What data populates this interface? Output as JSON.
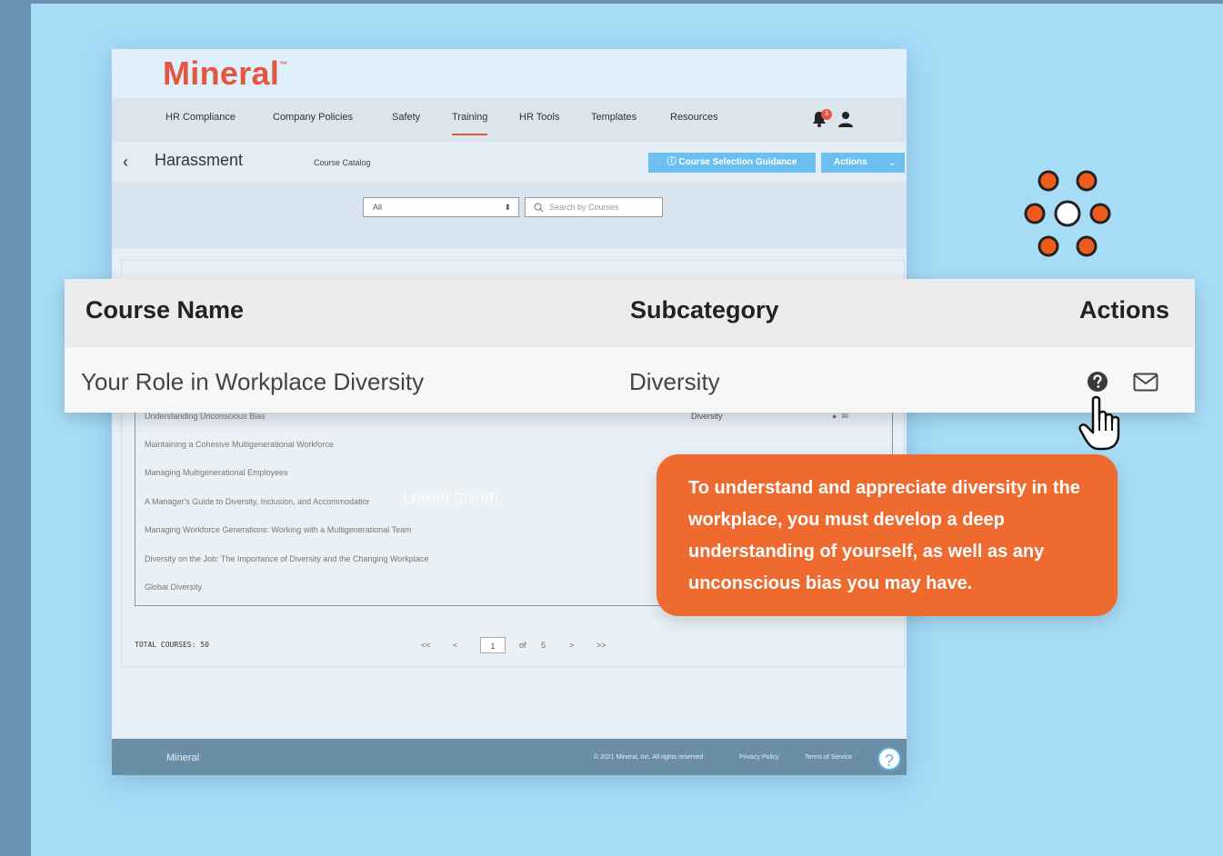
{
  "app": {
    "logo": "Mineral",
    "logo_tm": "™",
    "nav": [
      "HR Compliance",
      "Company Policies",
      "Safety",
      "Training",
      "HR Tools",
      "Templates",
      "Resources"
    ],
    "active_nav": "Training",
    "notification_count": "3",
    "page_title": "Harassment",
    "breadcrumb": "Course Catalog",
    "guidance_button": "Course Selection Guidance",
    "actions_button": "Actions",
    "filter_value": "All",
    "search_placeholder": "Search by Courses"
  },
  "course_list": {
    "rows": [
      {
        "name": "Understanding Unconscious Bias",
        "subcategory": "Diversity"
      },
      {
        "name": "Maintaining a Cohesive Multigenerational Workforce",
        "subcategory": ""
      },
      {
        "name": "Managing Multigenerational Employees",
        "subcategory": ""
      },
      {
        "name": "A Manager's Guide to Diversity, Inclusion, and Accommodatior",
        "subcategory": ""
      },
      {
        "name": "Managing Workforce Generations: Working with a Multigenerational Team",
        "subcategory": ""
      },
      {
        "name": "Diversity on the Job: The Importance of Diversity and the Changing Workplace",
        "subcategory": ""
      },
      {
        "name": "Global Diversity",
        "subcategory": ""
      }
    ],
    "lorem": "Lorem Ipsum",
    "total_label": "TOTAL COURSES: 50",
    "pager": {
      "first": "<<",
      "prev": "<",
      "current": "1",
      "of": "of",
      "pages": "5",
      "next": ">",
      "last": ">>"
    }
  },
  "footer": {
    "logo": "Mineral",
    "copyright": "© 2021 Mineral, Inc. All rights reserved",
    "privacy": "Privacy Policy",
    "terms": "Terms of Service",
    "help": "?"
  },
  "zoom_table": {
    "headers": [
      "Course Name",
      "Subcategory",
      "Actions"
    ],
    "row": {
      "name": "Your Role in Workplace Diversity",
      "subcategory": "Diversity"
    }
  },
  "tooltip": {
    "text": "To understand and appreciate diversity in the workplace, you must develop a deep understanding of yourself, as well as any unconscious bias you may have."
  },
  "colors": {
    "brand": "#e4563f",
    "accent": "#6cc0ef",
    "tooltip": "#ef6a2f",
    "background": "#a7dcf7"
  }
}
